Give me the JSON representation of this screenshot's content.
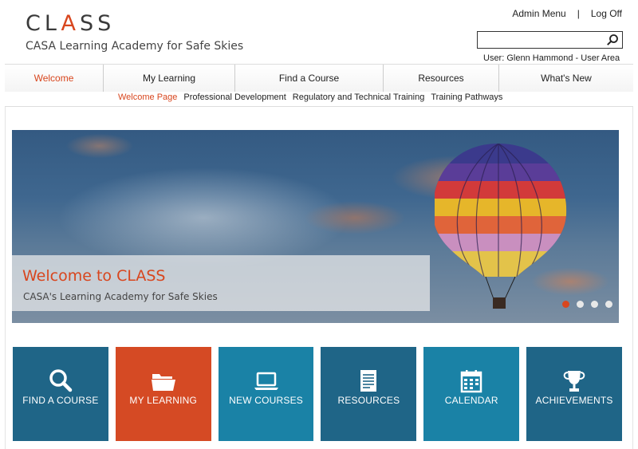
{
  "header": {
    "logo_prefix": "CL",
    "logo_accent": "A",
    "logo_suffix": "SS",
    "tagline": "CASA Learning Academy for Safe Skies",
    "admin_menu": "Admin Menu",
    "separator": "|",
    "log_off": "Log Off",
    "search_value": "",
    "search_icon": "magnifier-icon",
    "user_line": "User: Glenn Hammond - User Area"
  },
  "main_nav": {
    "items": [
      {
        "label": "Welcome",
        "active": true
      },
      {
        "label": "My Learning"
      },
      {
        "label": "Find a Course"
      },
      {
        "label": "Resources"
      },
      {
        "label": "What's New"
      }
    ]
  },
  "sub_nav": {
    "items": [
      {
        "label": "Welcome Page",
        "active": true
      },
      {
        "label": "Professional Development"
      },
      {
        "label": "Regulatory and Technical Training"
      },
      {
        "label": "Training Pathways"
      }
    ]
  },
  "hero": {
    "title": "Welcome to CLASS",
    "subtitle": "CASA's Learning Academy for Safe Skies",
    "slide_count": 4,
    "active_slide": 1
  },
  "tiles": [
    {
      "label": "FIND A COURSE",
      "icon": "search-icon",
      "color": "#1f6587"
    },
    {
      "label": "MY LEARNING",
      "icon": "folder-icon",
      "color": "#d54a24"
    },
    {
      "label": "NEW COURSES",
      "icon": "laptop-icon",
      "color": "#1a82a6"
    },
    {
      "label": "RESOURCES",
      "icon": "document-icon",
      "color": "#1f6587"
    },
    {
      "label": "CALENDAR",
      "icon": "calendar-icon",
      "color": "#1a82a6"
    },
    {
      "label": "ACHIEVEMENTS",
      "icon": "trophy-icon",
      "color": "#1f6587"
    }
  ],
  "colors": {
    "accent": "#d8461e",
    "tile_dark": "#1f6587",
    "tile_light": "#1a82a6"
  }
}
